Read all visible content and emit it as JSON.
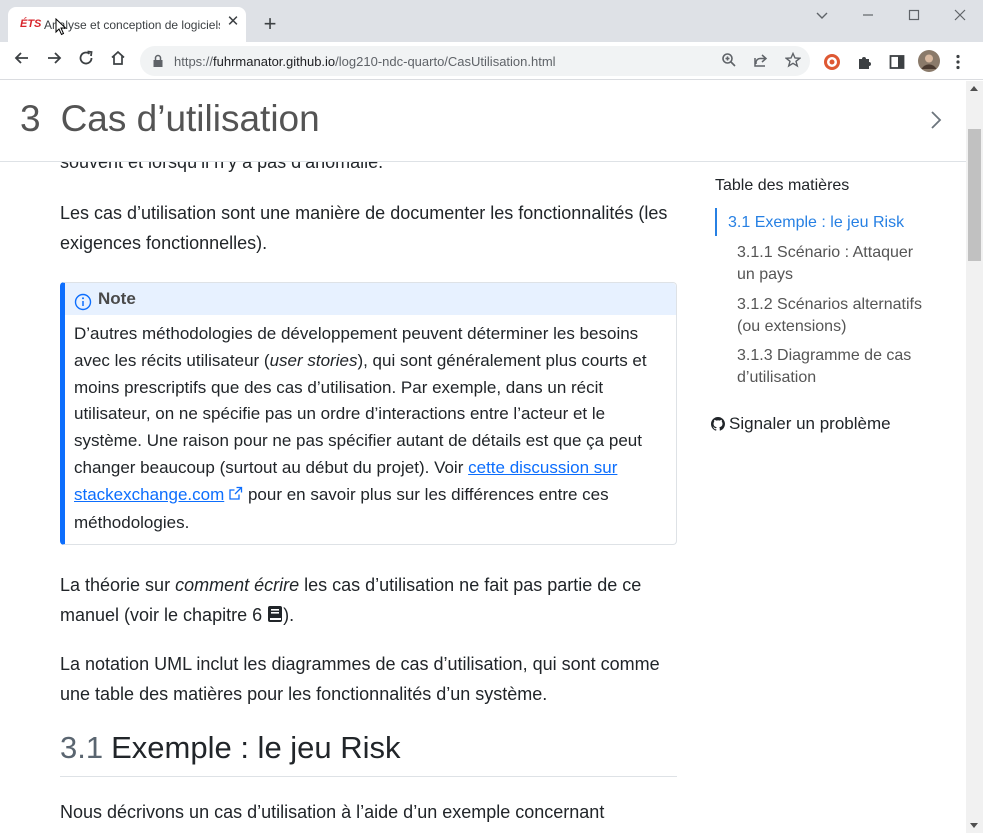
{
  "browser": {
    "tab_title": "Analyse et conception de logiciels",
    "tab_favicon_text": "ÉTS",
    "url_host": "fuhrmanator.github.io",
    "url_path": "/log210-ndc-quarto/CasUtilisation.html",
    "url_scheme": "https://"
  },
  "header": {
    "chapter_number": "3",
    "chapter_title": "Cas d’utilisation"
  },
  "content": {
    "partial_line": "souvent et lorsqu’il n’y a pas d’anomalie.",
    "p1": "Les cas d’utilisation sont une manière de documenter les fonctionnalités (les exigences fonctionnelles).",
    "note_title": "Note",
    "note_text_1": "D’autres méthodologies de développement peuvent déterminer les besoins avec les récits utilisateur (",
    "note_text_em": "user stories",
    "note_text_2": "), qui sont généralement plus courts et moins prescriptifs que des cas d’utilisation. Par exemple, dans un récit utilisateur, on ne spécifie pas un ordre d’interactions entre l’acteur et le système. Une raison pour ne pas spécifier autant de détails est que ça peut changer beaucoup (surtout au début du projet). Voir ",
    "note_link": "cette discussion sur stackexchange.com",
    "note_text_3": " pour en savoir plus sur les différences entre ces méthodologies.",
    "p2_a": "La théorie sur ",
    "p2_em": "comment écrire",
    "p2_b": " les cas d’utilisation ne fait pas partie de ce manuel (voir le chapitre 6 ",
    "p2_c": ").",
    "p3": "La notation UML inclut les diagrammes de cas d’utilisation, qui sont comme une table des matières pour les fonctionnalités d’un système.",
    "section_number": "3.1",
    "section_title": "Exemple : le jeu Risk",
    "p4": "Nous décrivons un cas d’utilisation à l’aide d’un exemple concernant"
  },
  "toc": {
    "title": "Table des matières",
    "items": [
      "3.1 Exemple : le jeu Risk",
      "3.1.1 Scénario : Attaquer un pays",
      "3.1.2 Scénarios alternatifs (ou extensions)",
      "3.1.3 Diagramme de cas d’utilisation"
    ],
    "report_issue": "Signaler un problème"
  },
  "colors": {
    "accent": "#2780e3",
    "callout_border": "#0d6efd",
    "callout_header_bg": "#e7f1ff"
  }
}
